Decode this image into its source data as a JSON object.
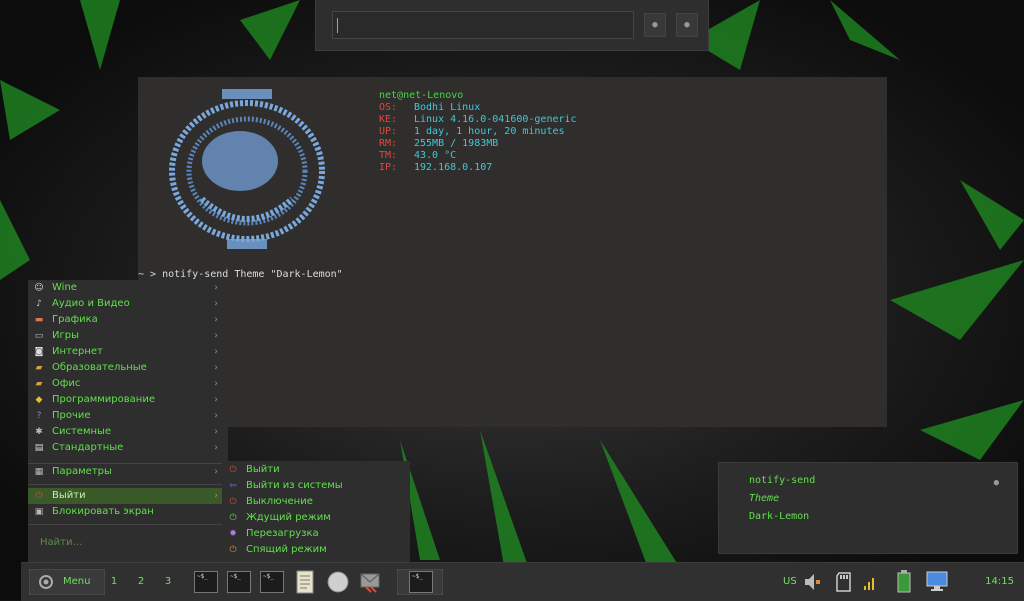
{
  "launcher": {
    "button1": "●",
    "button2": "●"
  },
  "terminal": {
    "user_host": "net@net-Lenovo",
    "info": [
      {
        "key": "OS:",
        "value": "Bodhi Linux"
      },
      {
        "key": "KE:",
        "value": "Linux 4.16.0-041600-generic"
      },
      {
        "key": "UP:",
        "value": "1 day, 1 hour, 20 minutes"
      },
      {
        "key": "RM:",
        "value": "255MB / 1983MB"
      },
      {
        "key": "TM:",
        "value": "43.0 °C"
      },
      {
        "key": "IP:",
        "value": "192.168.0.107"
      }
    ],
    "command": "~ > notify-send Theme \"Dark-Lemon\""
  },
  "appmenu": {
    "items": [
      {
        "label": "Wine",
        "icon": "wine-icon",
        "glyph": "☺"
      },
      {
        "label": "Аудио и Видео",
        "icon": "music-icon",
        "glyph": "♪"
      },
      {
        "label": "Графика",
        "icon": "graphics-icon",
        "glyph": "▬"
      },
      {
        "label": "Игры",
        "icon": "gamepad-icon",
        "glyph": "▭"
      },
      {
        "label": "Интернет",
        "icon": "internet-icon",
        "glyph": "◙"
      },
      {
        "label": "Образовательные",
        "icon": "folder-icon",
        "glyph": "▰"
      },
      {
        "label": "Офис",
        "icon": "folder-icon",
        "glyph": "▰"
      },
      {
        "label": "Программирование",
        "icon": "programming-icon",
        "glyph": "◆"
      },
      {
        "label": "Прочие",
        "icon": "help-icon",
        "glyph": "?"
      },
      {
        "label": "Системные",
        "icon": "gear-icon",
        "glyph": "✱"
      },
      {
        "label": "Стандартные",
        "icon": "document-icon",
        "glyph": "▤"
      }
    ],
    "settings": {
      "label": "Параметры",
      "icon": "settings-icon",
      "glyph": "▦"
    },
    "exit": {
      "label": "Выйти",
      "icon": "power-icon",
      "glyph": "⏻"
    },
    "lock": {
      "label": "Блокировать экран",
      "icon": "lock-icon",
      "glyph": "▣"
    },
    "arrow": "›",
    "search_placeholder": "Найти…"
  },
  "submenu": {
    "items": [
      {
        "label": "Выйти",
        "icon": "power-icon",
        "glyph": "⏻",
        "color": "#e04a2e"
      },
      {
        "label": "Выйти из системы",
        "icon": "logout-icon",
        "glyph": "⇦",
        "color": "#4a8ae0"
      },
      {
        "label": "Выключение",
        "icon": "shutdown-icon",
        "glyph": "⏻",
        "color": "#e04a2e"
      },
      {
        "label": "Ждущий режим",
        "icon": "suspend-icon",
        "glyph": "⏻",
        "color": "#6ad04a"
      },
      {
        "label": "Перезагрузка",
        "icon": "reboot-icon",
        "glyph": "✸",
        "color": "#b080e0"
      },
      {
        "label": "Спящий режим",
        "icon": "hibernate-icon",
        "glyph": "⏻",
        "color": "#e08a2e"
      }
    ]
  },
  "notification": {
    "app": "notify-send",
    "summary": "Theme",
    "body": "Dark-Lemon",
    "close": "●"
  },
  "taskbar": {
    "menu_label": "Menu",
    "workspaces": [
      "1",
      "2",
      "3"
    ],
    "term_icon_text": "~$_",
    "keyboard_layout": "US",
    "clock": "14:15"
  },
  "colors": {
    "accent": "#5fe24a",
    "panel": "#2e2e2e",
    "terminal_bg": "#2f2e2d",
    "info_key": "#e0483c",
    "info_value": "#40c8d8"
  }
}
